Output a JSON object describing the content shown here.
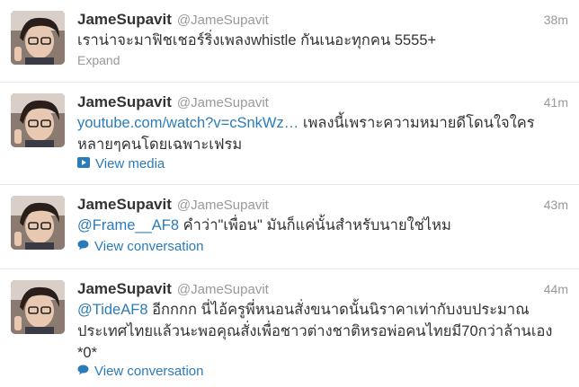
{
  "tweets": [
    {
      "fullname": "JameSupavit",
      "username": "@JameSupavit",
      "time": "38m",
      "text": "เราน่าจะมาฟิชเชอร์ริ่งเพลงwhistle กันเนอะทุกคน 5555+",
      "action": "Expand"
    },
    {
      "fullname": "JameSupavit",
      "username": "@JameSupavit",
      "time": "41m",
      "link": "youtube.com/watch?v=cSnkWz…",
      "text": " เพลงนี้เพราะความหมายดีโดนใจใครหลายๆคนโดยเฉพาะเฟรม",
      "action": "View media",
      "action_icon": "play-media-icon"
    },
    {
      "fullname": "JameSupavit",
      "username": "@JameSupavit",
      "time": "43m",
      "mention": "@Frame__AF8",
      "text": " คำว่า\"เพื่อน\" มันก็แค่นั้นสำหรับนายใช่ไหม",
      "action": "View conversation",
      "action_icon": "speech-bubble-icon"
    },
    {
      "fullname": "JameSupavit",
      "username": "@JameSupavit",
      "time": "44m",
      "mention": "@TideAF8",
      "text": " อีกกกก นี่ไอ้ครูพี่หนอนสั่งขนาดนั้นนิราคาเท่ากับงบประมาณประเทศไทยแล้วนะพอคุณสั่งเพื่อชาวต่างชาติหรอพ่อคนไทยมี70กว่าล้านเอง *0*",
      "action": "View conversation",
      "action_icon": "speech-bubble-icon"
    }
  ],
  "colors": {
    "link": "#2b7bb9",
    "muted": "#999999",
    "text": "#333333"
  }
}
